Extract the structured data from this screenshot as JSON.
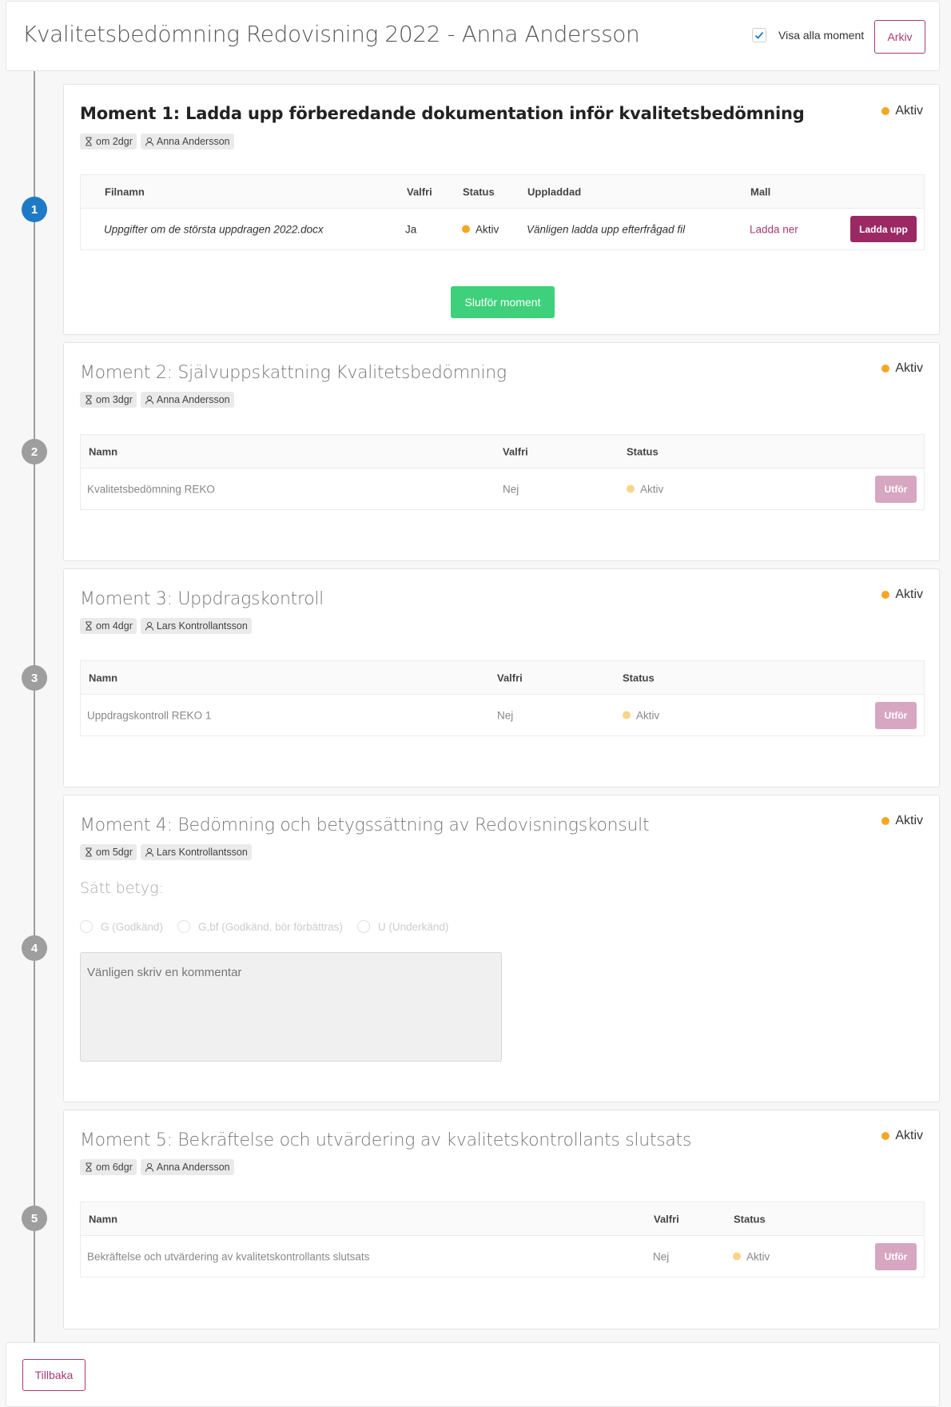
{
  "header": {
    "title": "Kvalitetsbedömning Redovisning 2022 - Anna Andersson",
    "show_all_label": "Visa alla moment",
    "archive_label": "Arkiv"
  },
  "colors": {
    "accent": "#a83a76",
    "active_step": "#1f7ac6",
    "success": "#3ed07a",
    "status_dot": "#f5a623"
  },
  "moments": [
    {
      "step": "1",
      "title": "Moment 1: Ladda upp förberedande dokumentation inför kvalitetsbedömning",
      "status": "Aktiv",
      "due": "om 2dgr",
      "person": "Anna Andersson",
      "table": {
        "headers": [
          "Filnamn",
          "Valfri",
          "Status",
          "Uppladdad",
          "Mall"
        ],
        "row": {
          "filename": "Uppgifter om de största uppdragen 2022.docx",
          "optional": "Ja",
          "status": "Aktiv",
          "uploaded": "Vänligen ladda upp efterfrågad fil",
          "template_link": "Ladda ner",
          "action": "Ladda upp"
        }
      },
      "complete_label": "Slutför moment"
    },
    {
      "step": "2",
      "title": "Moment 2: Självuppskattning Kvalitetsbedömning",
      "status": "Aktiv",
      "due": "om 3dgr",
      "person": "Anna Andersson",
      "table": {
        "headers": [
          "Namn",
          "Valfri",
          "Status"
        ],
        "row": {
          "name": "Kvalitetsbedömning REKO",
          "optional": "Nej",
          "status": "Aktiv",
          "action": "Utför"
        }
      }
    },
    {
      "step": "3",
      "title": "Moment 3: Uppdragskontroll",
      "status": "Aktiv",
      "due": "om 4dgr",
      "person": "Lars Kontrollantsson",
      "table": {
        "headers": [
          "Namn",
          "Valfri",
          "Status"
        ],
        "row": {
          "name": "Uppdragskontroll REKO 1",
          "optional": "Nej",
          "status": "Aktiv",
          "action": "Utför"
        }
      }
    },
    {
      "step": "4",
      "title": "Moment 4: Bedömning och betygssättning av Redovisningskonsult",
      "status": "Aktiv",
      "due": "om 5dgr",
      "person": "Lars Kontrollantsson",
      "grade_label": "Sätt betyg:",
      "grades": [
        "G (Godkänd)",
        "G,bf (Godkänd, bör förbättras)",
        "U (Underkänd)"
      ],
      "comment_placeholder": "Vänligen skriv en kommentar"
    },
    {
      "step": "5",
      "title": "Moment 5: Bekräftelse och utvärdering av kvalitetskontrollants slutsats",
      "status": "Aktiv",
      "due": "om 6dgr",
      "person": "Anna Andersson",
      "table": {
        "headers": [
          "Namn",
          "Valfri",
          "Status"
        ],
        "row": {
          "name": "Bekräftelse och utvärdering av kvalitetskontrollants slutsats",
          "optional": "Nej",
          "status": "Aktiv",
          "action": "Utför"
        }
      }
    }
  ],
  "footer": {
    "back_label": "Tillbaka"
  }
}
